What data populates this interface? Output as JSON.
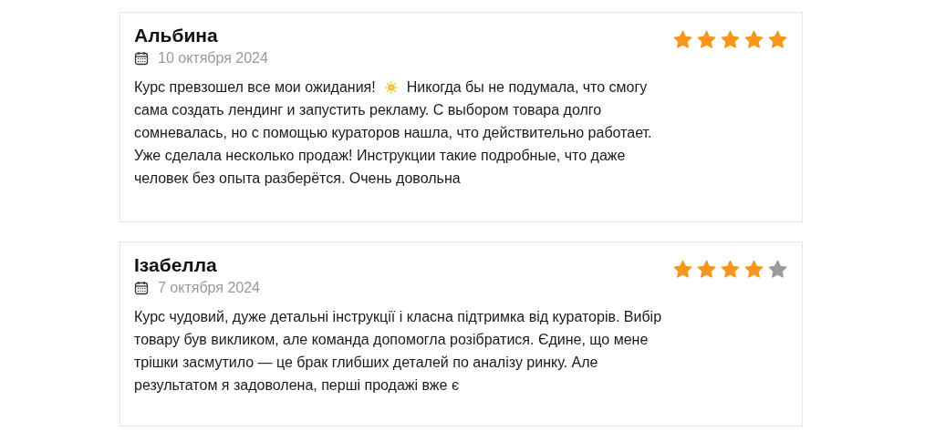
{
  "reviews": [
    {
      "name": "Альбина",
      "date": "10 октября 2024",
      "stars": 5,
      "lines": [
        [
          {
            "kind": "text",
            "text": "Курс превзошел все мои ожидания!"
          },
          {
            "kind": "sun"
          },
          {
            "kind": "text",
            "text": "Никогда бы не подумала, что смогу"
          }
        ],
        [
          {
            "kind": "text",
            "text": "сама создать лендинг и запустить рекламу. С выбором товара долго"
          }
        ],
        [
          {
            "kind": "text",
            "text": "сомневалась, но с помощью кураторов нашла, что действительно работает."
          }
        ],
        [
          {
            "kind": "text",
            "text": "Уже сделала несколько продаж! Инструкции такие подробные, что даже"
          }
        ],
        [
          {
            "kind": "text",
            "text": "человек без опыта разберётся. Очень довольна"
          }
        ]
      ]
    },
    {
      "name": "Ізабелла",
      "date": "7 октября 2024",
      "stars": 4,
      "lines": [
        [
          {
            "kind": "text",
            "text": "Курс чудовий, дуже детальні інструкції і класна підтримка від кураторів. Вибір"
          }
        ],
        [
          {
            "kind": "text",
            "text": "товару був викликом, але команда допомогла розібратися. Єдине, що мене"
          }
        ],
        [
          {
            "kind": "text",
            "text": "трішки засмутило — це брак глибших деталей по аналізу ринку. Але"
          }
        ],
        [
          {
            "kind": "text",
            "text": "результатом я задоволена, перші продажі вже є"
          }
        ]
      ]
    }
  ]
}
